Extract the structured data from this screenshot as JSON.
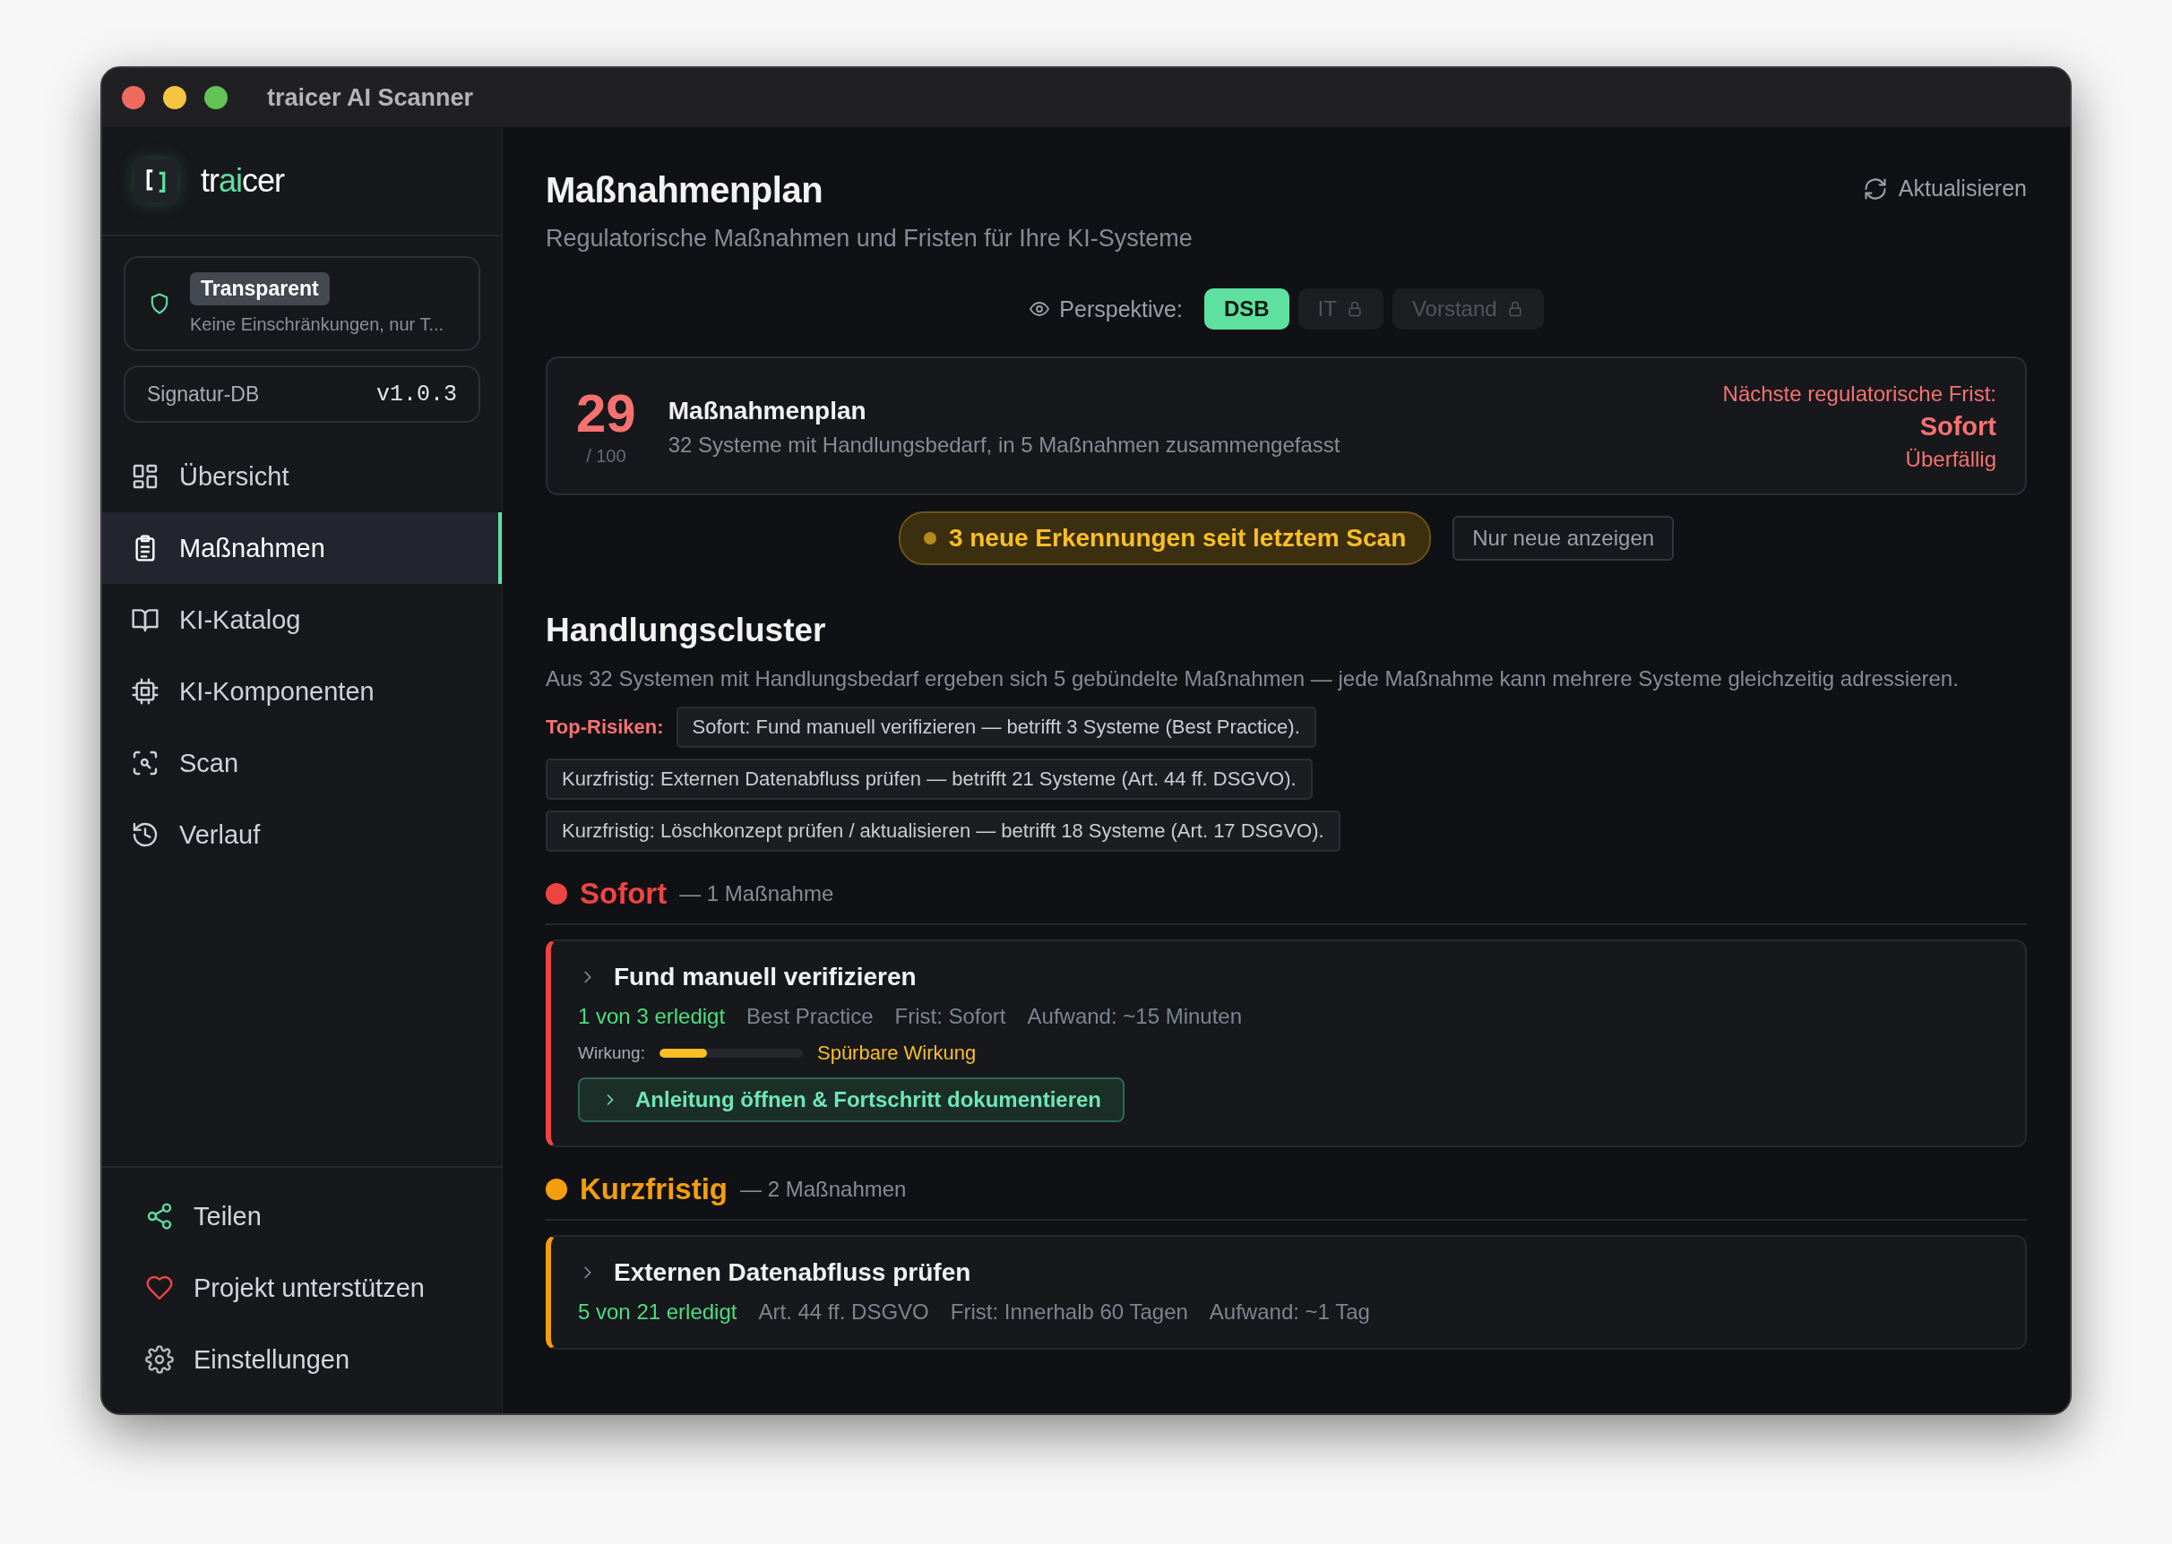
{
  "window": {
    "title": "traicer AI Scanner"
  },
  "sidebar": {
    "brand": {
      "prefix": "tr",
      "accent": "ai",
      "suffix": "cer"
    },
    "mode": {
      "badge": "Transparent",
      "description": "Keine Einschränkungen, nur T..."
    },
    "signature": {
      "label": "Signatur-DB",
      "version": "v1.0.3"
    },
    "nav": [
      {
        "label": "Übersicht",
        "selected": false
      },
      {
        "label": "Maßnahmen",
        "selected": true
      },
      {
        "label": "KI-Katalog",
        "selected": false
      },
      {
        "label": "KI-Komponenten",
        "selected": false
      },
      {
        "label": "Scan",
        "selected": false
      },
      {
        "label": "Verlauf",
        "selected": false
      }
    ],
    "footer": [
      {
        "label": "Teilen"
      },
      {
        "label": "Projekt unterstützen"
      },
      {
        "label": "Einstellungen"
      }
    ]
  },
  "header": {
    "title": "Maßnahmenplan",
    "subtitle": "Regulatorische Maßnahmen und Fristen für Ihre KI-Systeme",
    "refresh": "Aktualisieren"
  },
  "perspective": {
    "label": "Perspektive:",
    "options": [
      {
        "label": "DSB",
        "selected": true,
        "locked": false
      },
      {
        "label": "IT",
        "selected": false,
        "locked": true
      },
      {
        "label": "Vorstand",
        "selected": false,
        "locked": true
      }
    ]
  },
  "summary": {
    "score": "29",
    "max": "/ 100",
    "title": "Maßnahmenplan",
    "description": "32 Systeme mit Handlungsbedarf, in 5 Maßnahmen zusammengefasst",
    "deadline_label": "Nächste regulatorische Frist:",
    "deadline_value": "Sofort",
    "deadline_status": "Überfällig"
  },
  "banner": {
    "text": "3 neue Erkennungen seit letztem Scan",
    "button": "Nur neue anzeigen"
  },
  "clusters": {
    "title": "Handlungscluster",
    "description": "Aus 32 Systemen mit Handlungsbedarf ergeben sich 5 gebündelte Maßnahmen — jede Maßnahme kann mehrere Systeme gleichzeitig adressieren.",
    "top_label": "Top-Risiken:",
    "risks": [
      "Sofort: Fund manuell verifizieren — betrifft 3 Systeme (Best Practice).",
      "Kurzfristig: Externen Datenabfluss prüfen — betrifft 21 Systeme (Art. 44 ff. DSGVO).",
      "Kurzfristig: Löschkonzept prüfen / aktualisieren — betrifft 18 Systeme (Art. 17 DSGVO)."
    ]
  },
  "groups": [
    {
      "name": "Sofort",
      "count": "— 1 Maßnahme",
      "color": "#ef4444",
      "actions": [
        {
          "title": "Fund manuell verifizieren",
          "progress": "1 von 3 erledigt",
          "source": "Best Practice",
          "deadline": "Frist: Sofort",
          "effort": "Aufwand: ~15 Minuten",
          "impact_label": "Wirkung:",
          "level": 0.33,
          "impact_text": "Spürbare Wirkung",
          "button": "Anleitung öffnen & Fortschritt dokumentieren"
        }
      ]
    },
    {
      "name": "Kurzfristig",
      "count": "— 2 Maßnahmen",
      "color": "#f59e0b",
      "actions": [
        {
          "title": "Externen Datenabfluss prüfen",
          "progress": "5 von 21 erledigt",
          "source": "Art. 44 ff. DSGVO",
          "deadline": "Frist: Innerhalb 60 Tagen",
          "effort": "Aufwand: ~1 Tag"
        }
      ]
    }
  ]
}
